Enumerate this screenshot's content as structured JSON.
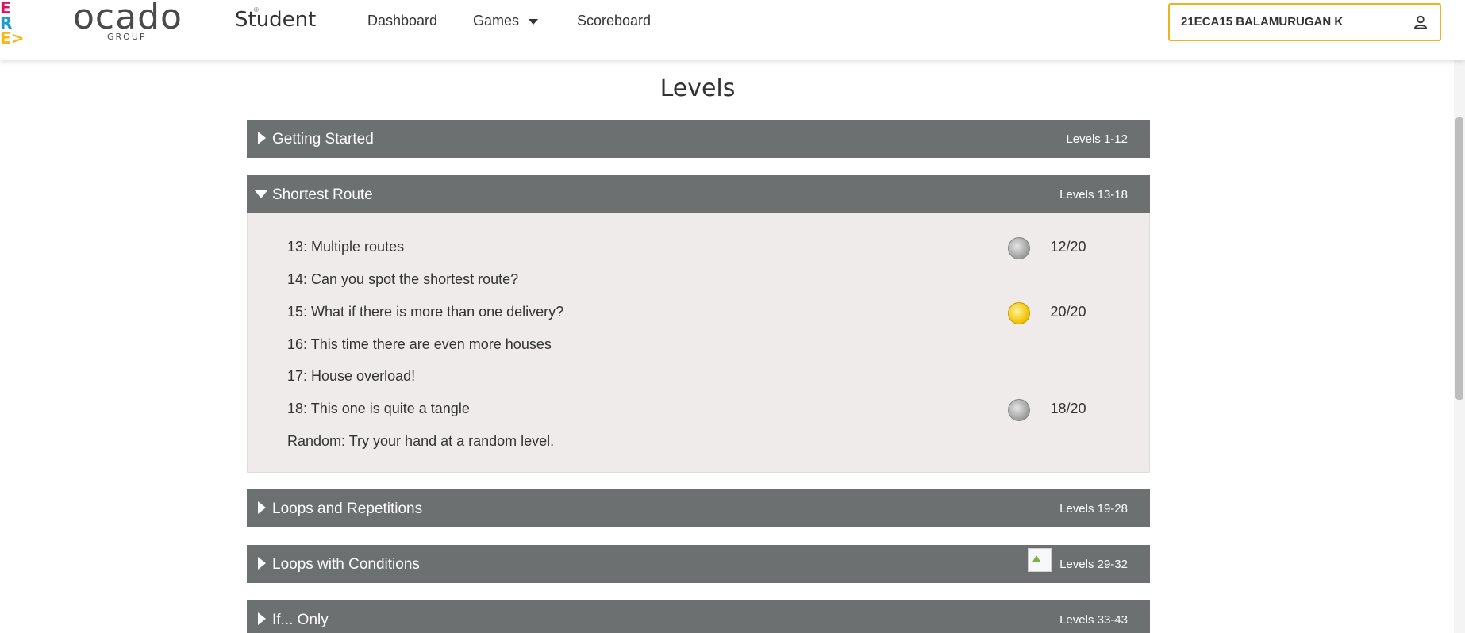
{
  "brand": {
    "cfl_letters": [
      "E",
      "R",
      "E>"
    ],
    "logo_word": "ocado",
    "logo_reg": "®",
    "logo_group": "GROUP",
    "page_title": "Student"
  },
  "nav": {
    "dashboard": "Dashboard",
    "games": "Games",
    "scoreboard": "Scoreboard"
  },
  "user": {
    "name": "21ECA15 BALAMURUGAN K"
  },
  "heading": "Levels",
  "episodes": [
    {
      "name": "Getting Started",
      "range": "Levels 1-12",
      "expanded": false
    },
    {
      "name": "Shortest Route",
      "range": "Levels 13-18",
      "expanded": true
    },
    {
      "name": "Loops and Repetitions",
      "range": "Levels 19-28",
      "expanded": false
    },
    {
      "name": "Loops with Conditions",
      "range": "Levels 29-32",
      "expanded": false
    },
    {
      "name": "If... Only",
      "range": "Levels 33-43",
      "expanded": false
    }
  ],
  "levels": [
    {
      "name": "13: Multiple routes",
      "medal": "silver",
      "score": "12/20"
    },
    {
      "name": "14: Can you spot the shortest route?",
      "medal": "",
      "score": ""
    },
    {
      "name": "15: What if there is more than one delivery?",
      "medal": "gold",
      "score": "20/20"
    },
    {
      "name": "16: This time there are even more houses",
      "medal": "",
      "score": ""
    },
    {
      "name": "17: House overload!",
      "medal": "",
      "score": ""
    },
    {
      "name": "18: This one is quite a tangle",
      "medal": "silver",
      "score": "18/20"
    },
    {
      "name": "Random: Try your hand at a random level.",
      "medal": "",
      "score": ""
    }
  ],
  "colors": {
    "header_bar": "#6c7070",
    "panel_bg": "#efebea",
    "user_border": "#f2b21b",
    "cfl_pink": "#e0105f",
    "cfl_blue": "#1e9bd7",
    "cfl_yellow": "#f6b817"
  },
  "icons": {
    "user": "user-icon",
    "games_dropdown": "chevron-down-icon",
    "collapsed": "triangle-right-icon",
    "expanded": "triangle-down-icon",
    "silver_medal": "silver-coin-icon",
    "gold_medal": "gold-coin-icon",
    "broken_image": "broken-image-icon"
  }
}
